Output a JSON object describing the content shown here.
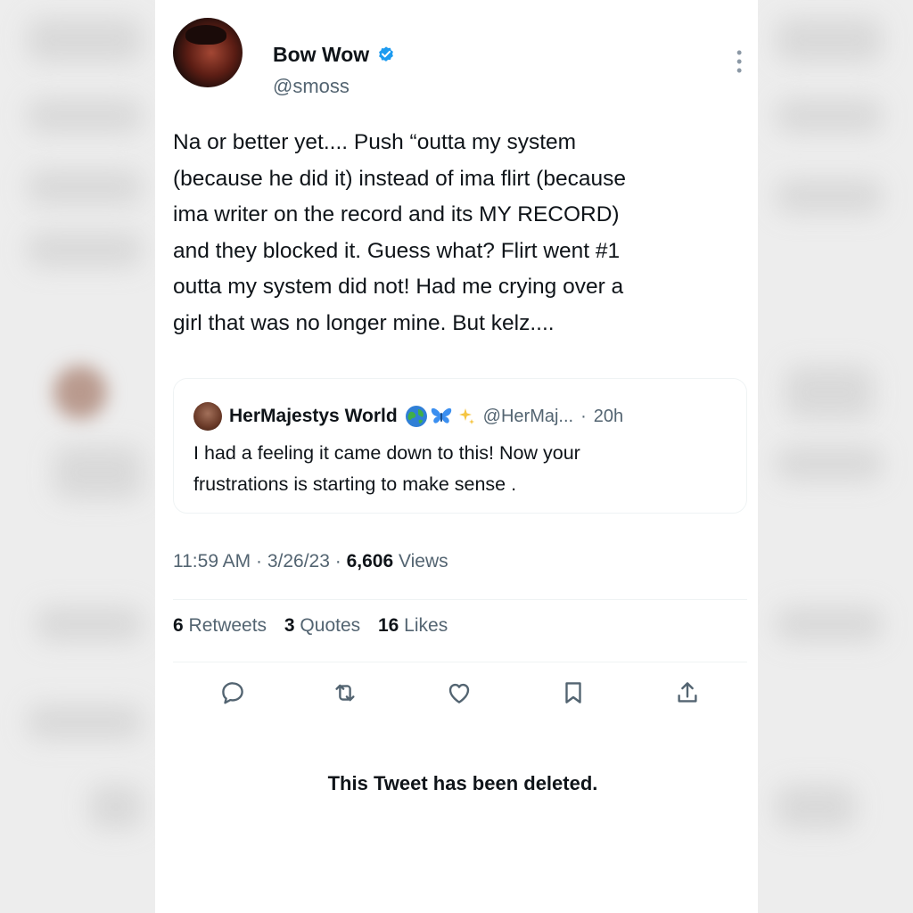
{
  "author": {
    "display_name": "Bow Wow",
    "handle": "@smoss",
    "verified": true,
    "verified_color": "#1d9bf0"
  },
  "tweet": {
    "lines": [
      "Na or better yet.... Push “outta my system",
      "(because he did it) instead of ima flirt (because",
      "ima writer on the record and its MY RECORD)",
      "and they blocked it. Guess what? Flirt went #1",
      "outta my system did not! Had me crying over a",
      "girl that was no longer mine. But kelz...."
    ]
  },
  "quoted_tweet": {
    "display_name": "HerMajestys World",
    "emojis": [
      "globe-icon",
      "butterfly-icon",
      "sparkles-icon"
    ],
    "handle": "@HerMaj...",
    "separator": "·",
    "time": "20h",
    "lines": [
      "I had a feeling it came down to this! Now your",
      "frustrations is starting to make sense ."
    ]
  },
  "meta": {
    "time": "11:59 AM",
    "sep1": " · ",
    "date": "3/26/23",
    "sep2": " · ",
    "views_count": "6,606",
    "views_label": " Views"
  },
  "stats": {
    "retweets_count": "6",
    "retweets_label": " Retweets",
    "quotes_count": "3",
    "quotes_label": " Quotes",
    "likes_count": "16",
    "likes_label": " Likes"
  },
  "actions": [
    "reply-icon",
    "retweet-icon",
    "like-icon",
    "bookmark-icon",
    "share-icon"
  ],
  "deleted_notice": "This Tweet has been deleted.",
  "colors": {
    "text_primary": "#0f1419",
    "text_secondary": "#536471",
    "accent": "#1d9bf0",
    "divider": "#eff3f4"
  }
}
